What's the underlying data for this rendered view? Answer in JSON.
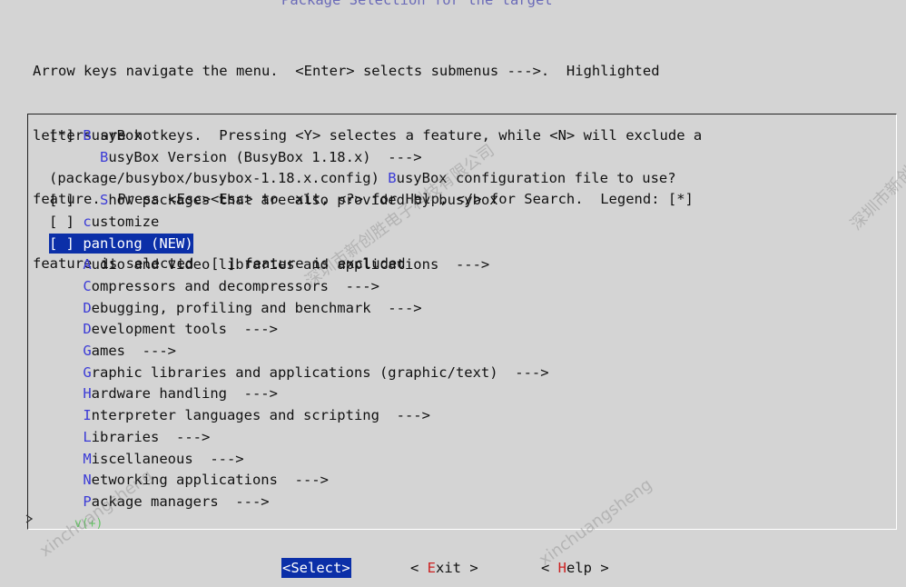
{
  "header": {
    "title": "Package Selection for the target"
  },
  "legend": {
    "lines": [
      "Arrow keys navigate the menu.  <Enter> selects submenus --->.  Highlighted",
      "letters are hotkeys.  Pressing <Y> selectes a feature, while <N> will exclude a",
      "feature.  Press <Esc><Esc> to exit, <?> for Help, </> for Search.  Legend: [*]",
      "feature is selected  [ ] feature is excluded"
    ]
  },
  "menu": {
    "items": [
      {
        "prefix": "[*] ",
        "hotkey": "B",
        "rest": "usyBox"
      },
      {
        "prefix": "      ",
        "hotkey": "B",
        "rest": "usyBox Version (BusyBox 1.18.x)  --->"
      },
      {
        "prefix": "(package/busybox/busybox-1.18.x.config) ",
        "hotkey": "B",
        "rest": "usyBox configuration file to use?"
      },
      {
        "prefix": "[ ]   ",
        "hotkey": "S",
        "rest": "how packages that are also provided by busybox"
      },
      {
        "prefix": "[ ] ",
        "hotkey": "c",
        "rest": "ustomize"
      },
      {
        "prefix": "[ ] ",
        "hotkey": "p",
        "rest": "anlong (NEW)"
      },
      {
        "prefix": "    ",
        "hotkey": "A",
        "rest": "udio and video libraries and applications  --->"
      },
      {
        "prefix": "    ",
        "hotkey": "C",
        "rest": "ompressors and decompressors  --->"
      },
      {
        "prefix": "    ",
        "hotkey": "D",
        "rest": "ebugging, profiling and benchmark  --->"
      },
      {
        "prefix": "    ",
        "hotkey": "D",
        "rest": "evelopment tools  --->"
      },
      {
        "prefix": "    ",
        "hotkey": "G",
        "rest": "ames  --->"
      },
      {
        "prefix": "    ",
        "hotkey": "G",
        "rest": "raphic libraries and applications (graphic/text)  --->"
      },
      {
        "prefix": "    ",
        "hotkey": "H",
        "rest": "ardware handling  --->"
      },
      {
        "prefix": "    ",
        "hotkey": "I",
        "rest": "nterpreter languages and scripting  --->"
      },
      {
        "prefix": "    ",
        "hotkey": "L",
        "rest": "ibraries  --->"
      },
      {
        "prefix": "    ",
        "hotkey": "M",
        "rest": "iscellaneous  --->"
      },
      {
        "prefix": "    ",
        "hotkey": "N",
        "rest": "etworking applications  --->"
      },
      {
        "prefix": "    ",
        "hotkey": "P",
        "rest": "ackage managers  --->"
      }
    ],
    "selected_index": 5,
    "more_hint": "v(+)"
  },
  "buttons": {
    "select": {
      "open": "<",
      "label": "Select",
      "close": ">"
    },
    "exit": {
      "open": "< ",
      "hotkey": "E",
      "rest": "xit",
      "close": " >"
    },
    "help": {
      "open": "< ",
      "hotkey": "H",
      "rest": "elp",
      "close": " >"
    }
  },
  "watermarks": [
    "深圳市新创胜电子科技有限公司",
    "xinchuangsheng"
  ],
  "colors": {
    "background": "#d4d4d4",
    "hotkey": "#3b3bd6",
    "selection": "#0b2fa8",
    "exit_help_hotkey": "#cc2222"
  }
}
